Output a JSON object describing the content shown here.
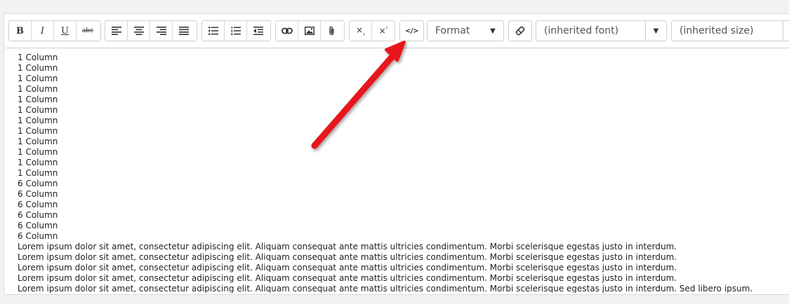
{
  "toolbar": {
    "format_label": "Format",
    "font_label": "(inherited font)",
    "size_label": "(inherited size)",
    "strike_label": "abc",
    "bold_label": "B",
    "italic_label": "I",
    "underline_label": "U"
  },
  "content": {
    "lines": [
      "1 Column",
      "1 Column",
      "1 Column",
      "1 Column",
      "1 Column",
      "1 Column",
      "1 Column",
      "1 Column",
      "1 Column",
      "1 Column",
      "1 Column",
      "1 Column",
      "6 Column",
      "6 Column",
      "6 Column",
      "6 Column",
      "6 Column",
      "6 Column",
      "Lorem ipsum dolor sit amet, consectetur adipiscing elit. Aliquam consequat ante mattis ultricies condimentum. Morbi scelerisque egestas justo in interdum.",
      "Lorem ipsum dolor sit amet, consectetur adipiscing elit. Aliquam consequat ante mattis ultricies condimentum. Morbi scelerisque egestas justo in interdum.",
      "Lorem ipsum dolor sit amet, consectetur adipiscing elit. Aliquam consequat ante mattis ultricies condimentum. Morbi scelerisque egestas justo in interdum.",
      "Lorem ipsum dolor sit amet, consectetur adipiscing elit. Aliquam consequat ante mattis ultricies condimentum. Morbi scelerisque egestas justo in interdum.",
      "Lorem ipsum dolor sit amet, consectetur adipiscing elit. Aliquam consequat ante mattis ultricies condimentum. Morbi scelerisque egestas justo in interdum. Sed libero ipsum."
    ]
  },
  "annotation": {
    "arrow_color": "#e8141b",
    "points_to": "source-code-button"
  }
}
